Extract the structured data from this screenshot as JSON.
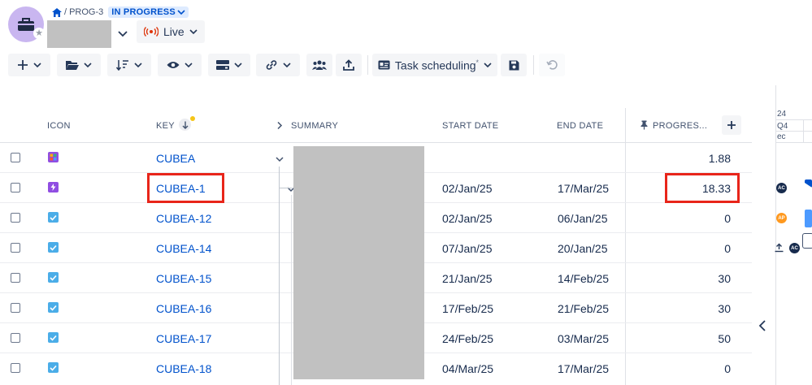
{
  "header": {
    "breadcrumb_sep": "/",
    "project_key": "PROG-3",
    "status": "IN PROGRESS",
    "live_label": "Live"
  },
  "toolbar": {
    "view_name": "Task scheduling",
    "view_modified_marker": "*"
  },
  "table": {
    "columns": {
      "icon": "ICON",
      "key": "KEY",
      "summary": "SUMMARY",
      "start_date": "START DATE",
      "end_date": "END DATE",
      "progress": "PROGRES..."
    },
    "rows": [
      {
        "type": "epic",
        "key": "CUBEA",
        "start": "",
        "end": "",
        "progress": "1.88"
      },
      {
        "type": "story",
        "key": "CUBEA-1",
        "start": "02/Jan/25",
        "end": "17/Mar/25",
        "progress": "18.33"
      },
      {
        "type": "task",
        "key": "CUBEA-12",
        "start": "02/Jan/25",
        "end": "06/Jan/25",
        "progress": "0"
      },
      {
        "type": "task",
        "key": "CUBEA-14",
        "start": "07/Jan/25",
        "end": "20/Jan/25",
        "progress": "0"
      },
      {
        "type": "task",
        "key": "CUBEA-15",
        "start": "21/Jan/25",
        "end": "14/Feb/25",
        "progress": "30"
      },
      {
        "type": "task",
        "key": "CUBEA-16",
        "start": "17/Feb/25",
        "end": "21/Feb/25",
        "progress": "30"
      },
      {
        "type": "task",
        "key": "CUBEA-17",
        "start": "24/Feb/25",
        "end": "03/Mar/25",
        "progress": "50"
      },
      {
        "type": "task",
        "key": "CUBEA-18",
        "start": "04/Mar/25",
        "end": "17/Mar/25",
        "progress": "0"
      }
    ]
  },
  "gantt": {
    "year": "24",
    "quarter": "Q4",
    "month": "ec",
    "avatars": [
      "AC",
      "AP",
      "AC"
    ]
  },
  "colors": {
    "accent": "#0052cc",
    "highlight": "#e8251a",
    "task_icon": "#4bade8",
    "story_icon": "#904ee2",
    "redaction": "#c1c1c1"
  }
}
